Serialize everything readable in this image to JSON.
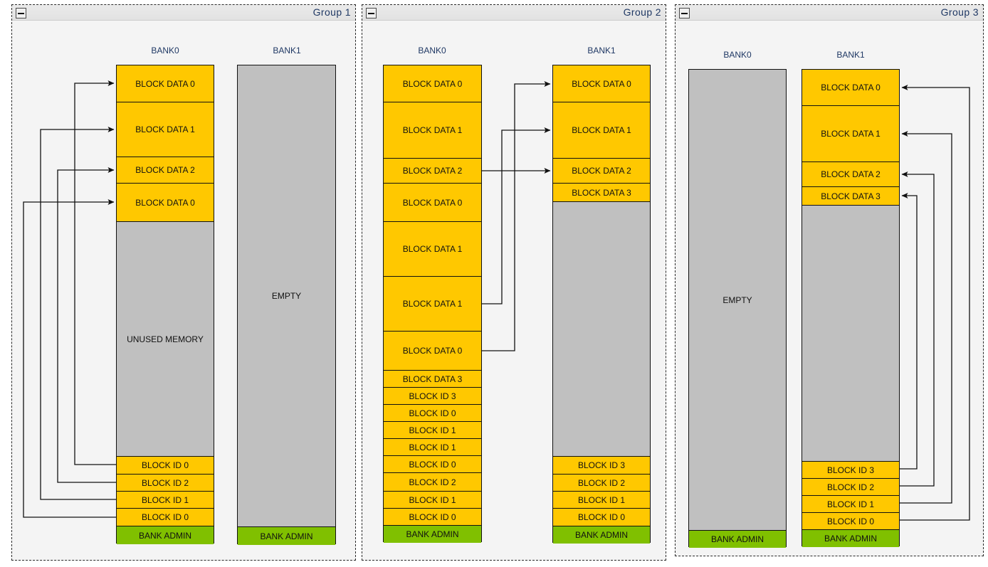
{
  "groups": [
    {
      "id": "group-1",
      "title": "Group 1",
      "collapse_tooltip": "collapse",
      "banks": [
        {
          "name": "BANK0",
          "cells": [
            {
              "label": "BLOCK DATA 0",
              "kind": "data"
            },
            {
              "label": "BLOCK DATA 1",
              "kind": "data"
            },
            {
              "label": "BLOCK DATA 2",
              "kind": "data"
            },
            {
              "label": "BLOCK DATA 0",
              "kind": "data"
            },
            {
              "label": "UNUSED MEMORY",
              "kind": "unused"
            },
            {
              "label": "BLOCK ID 0",
              "kind": "id"
            },
            {
              "label": "BLOCK ID 2",
              "kind": "id"
            },
            {
              "label": "BLOCK ID 1",
              "kind": "id"
            },
            {
              "label": "BLOCK ID 0",
              "kind": "id"
            },
            {
              "label": "BANK ADMIN",
              "kind": "admin"
            }
          ]
        },
        {
          "name": "BANK1",
          "cells": [
            {
              "label": "EMPTY",
              "kind": "empty"
            },
            {
              "label": "BANK ADMIN",
              "kind": "admin"
            }
          ]
        }
      ]
    },
    {
      "id": "group-2",
      "title": "Group 2",
      "collapse_tooltip": "collapse",
      "banks": [
        {
          "name": "BANK0",
          "cells": [
            {
              "label": "BLOCK DATA 0",
              "kind": "data"
            },
            {
              "label": "BLOCK DATA 1",
              "kind": "data"
            },
            {
              "label": "BLOCK DATA 2",
              "kind": "data"
            },
            {
              "label": "BLOCK DATA 0",
              "kind": "data"
            },
            {
              "label": "BLOCK DATA 1",
              "kind": "data"
            },
            {
              "label": "BLOCK DATA 1",
              "kind": "data"
            },
            {
              "label": "BLOCK DATA 0",
              "kind": "data"
            },
            {
              "label": "BLOCK DATA 3",
              "kind": "data"
            },
            {
              "label": "BLOCK ID 3",
              "kind": "id"
            },
            {
              "label": "BLOCK ID 0",
              "kind": "id"
            },
            {
              "label": "BLOCK ID 1",
              "kind": "id"
            },
            {
              "label": "BLOCK ID 1",
              "kind": "id"
            },
            {
              "label": "BLOCK ID 0",
              "kind": "id"
            },
            {
              "label": "BLOCK ID 2",
              "kind": "id"
            },
            {
              "label": "BLOCK ID 1",
              "kind": "id"
            },
            {
              "label": "BLOCK ID 0",
              "kind": "id"
            },
            {
              "label": "BANK ADMIN",
              "kind": "admin"
            }
          ]
        },
        {
          "name": "BANK1",
          "cells": [
            {
              "label": "BLOCK DATA 0",
              "kind": "data"
            },
            {
              "label": "BLOCK DATA 1",
              "kind": "data"
            },
            {
              "label": "BLOCK DATA 2",
              "kind": "data"
            },
            {
              "label": "BLOCK DATA 3",
              "kind": "data"
            },
            {
              "label": "",
              "kind": "empty"
            },
            {
              "label": "BLOCK ID 3",
              "kind": "id"
            },
            {
              "label": "BLOCK ID 2",
              "kind": "id"
            },
            {
              "label": "BLOCK ID 1",
              "kind": "id"
            },
            {
              "label": "BLOCK ID 0",
              "kind": "id"
            },
            {
              "label": "BANK ADMIN",
              "kind": "admin"
            }
          ]
        }
      ]
    },
    {
      "id": "group-3",
      "title": "Group 3",
      "collapse_tooltip": "collapse",
      "banks": [
        {
          "name": "BANK0",
          "cells": [
            {
              "label": "EMPTY",
              "kind": "empty"
            },
            {
              "label": "BANK ADMIN",
              "kind": "admin"
            }
          ]
        },
        {
          "name": "BANK1",
          "cells": [
            {
              "label": "BLOCK DATA 0",
              "kind": "data"
            },
            {
              "label": "BLOCK DATA 1",
              "kind": "data"
            },
            {
              "label": "BLOCK DATA 2",
              "kind": "data"
            },
            {
              "label": "BLOCK DATA 3",
              "kind": "data"
            },
            {
              "label": "",
              "kind": "empty"
            },
            {
              "label": "BLOCK ID 3",
              "kind": "id"
            },
            {
              "label": "BLOCK ID 2",
              "kind": "id"
            },
            {
              "label": "BLOCK ID 1",
              "kind": "id"
            },
            {
              "label": "BLOCK ID 0",
              "kind": "id"
            },
            {
              "label": "BANK ADMIN",
              "kind": "admin"
            }
          ]
        }
      ]
    }
  ],
  "colors": {
    "data_block": "#ffc800",
    "id_block": "#ffc800",
    "admin_block": "#80c000",
    "empty_memory": "#c0c0c0",
    "unused_memory": "#c0c0c0",
    "panel_background": "#f4f4f4",
    "border": "#111111",
    "title_text": "#1f3864"
  },
  "g1_bank0_cell_tops": [
    91,
    143,
    220,
    257,
    311,
    641,
    666,
    690,
    714,
    739,
    763
  ],
  "g1_bank1_cell_tops": [
    91,
    740,
    765
  ],
  "g2_bank0_cell_tops": [
    91,
    143,
    222,
    257,
    311,
    388,
    465,
    520,
    544,
    568,
    592,
    616,
    640,
    664,
    690,
    714,
    738,
    762
  ],
  "g2_bank1_cell_tops": [
    91,
    143,
    222,
    257,
    283,
    641,
    666,
    690,
    714,
    739,
    763
  ],
  "g3_bank0_cell_tops": [
    97,
    745,
    769
  ],
  "g3_bank1_cell_tops": [
    97,
    148,
    227,
    262,
    288,
    648,
    672,
    696,
    720,
    744,
    768
  ]
}
